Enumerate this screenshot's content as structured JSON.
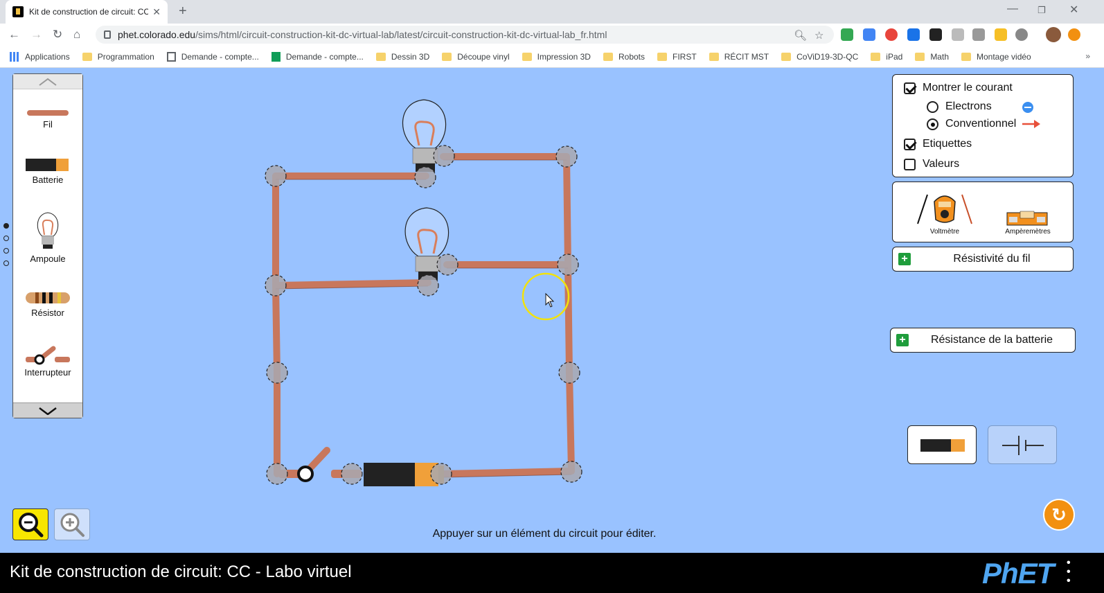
{
  "browser": {
    "tab_title": "Kit de construction de circuit: CC",
    "url_host": "phet.colorado.edu",
    "url_path": "/sims/html/circuit-construction-kit-dc-virtual-lab/latest/circuit-construction-kit-dc-virtual-lab_fr.html",
    "bookmarks": [
      "Applications",
      "Programmation",
      "Demande - compte...",
      "Demande - compte...",
      "Dessin 3D",
      "Découpe vinyl",
      "Impression 3D",
      "Robots",
      "FIRST",
      "RÉCIT MST",
      "CoViD19-3D-QC",
      "iPad",
      "Math",
      "Montage vidéo"
    ],
    "more_bookmarks": "»"
  },
  "carousel": {
    "items": [
      "Fil",
      "Batterie",
      "Ampoule",
      "Résistor",
      "Interrupteur"
    ]
  },
  "display_options": {
    "show_current": "Montrer le courant",
    "show_current_checked": true,
    "electrons": "Electrons",
    "conventional": "Conventionnel",
    "selected_current_type": "Conventionnel",
    "labels": "Etiquettes",
    "labels_checked": true,
    "values": "Valeurs",
    "values_checked": false
  },
  "tools": {
    "voltmeter": "Voltmètre",
    "ammeter": "Ampèremètres"
  },
  "accordions": {
    "wire_resistivity": "Résistivité du fil",
    "battery_resistance": "Résistance de la batterie"
  },
  "hint": "Appuyer sur un élément du circuit pour éditer.",
  "sim_title": "Kit de construction de circuit: CC - Labo virtuel",
  "phet_logo": "PhET",
  "colors": {
    "background": "#99c2ff",
    "wire": "#c8775c",
    "vertex": "#a8a8b0",
    "zoom_active": "#f8e600",
    "reset": "#f29010",
    "plus": "#1f9d3c"
  }
}
